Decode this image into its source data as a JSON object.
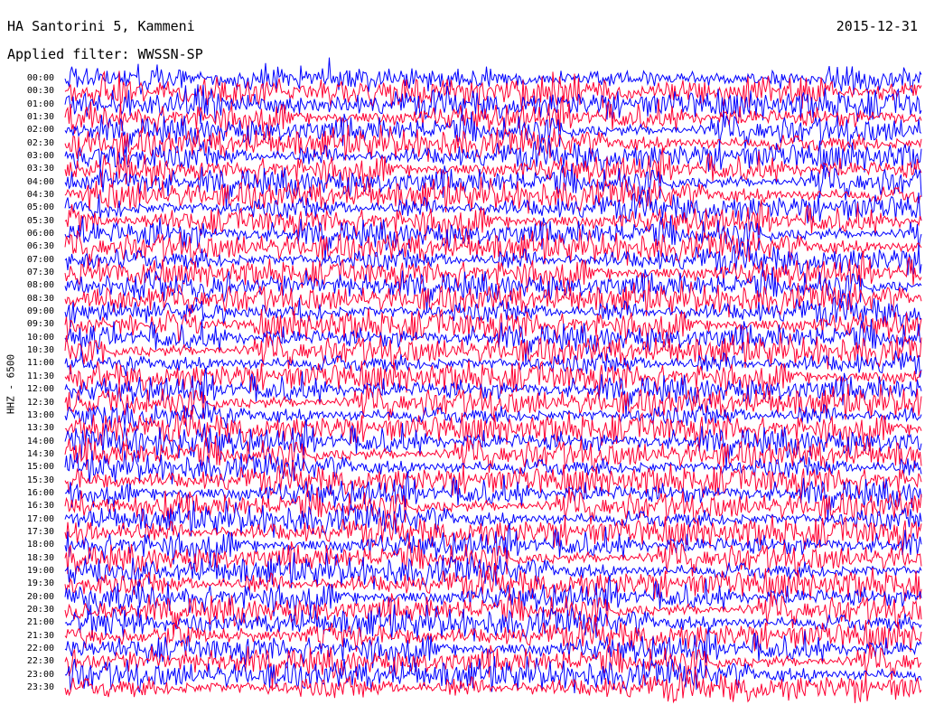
{
  "header": {
    "station": "HA Santorini 5, Kammeni",
    "date": "2015-12-31",
    "filter": "Applied filter: WWSSN-SP"
  },
  "channel_label": "HHZ - 6500",
  "colors": {
    "trace_a": "#0000ff",
    "trace_b": "#ff0033",
    "background": "#ffffff"
  },
  "chart_data": {
    "type": "line",
    "title": "HA Santorini 5, Kammeni",
    "subtitle": "Applied filter: WWSSN-SP",
    "ylabel": "HHZ - 6500",
    "row_labels": [
      "00:00",
      "00:30",
      "01:00",
      "01:30",
      "02:00",
      "02:30",
      "03:00",
      "03:30",
      "04:00",
      "04:30",
      "05:00",
      "05:30",
      "06:00",
      "06:30",
      "07:00",
      "07:30",
      "08:00",
      "08:30",
      "09:00",
      "09:30",
      "10:00",
      "10:30",
      "11:00",
      "11:30",
      "12:00",
      "12:30",
      "13:00",
      "13:30",
      "14:00",
      "14:30",
      "15:00",
      "15:30",
      "16:00",
      "16:30",
      "17:00",
      "17:30",
      "18:00",
      "18:30",
      "19:00",
      "19:30",
      "20:00",
      "20:30",
      "21:00",
      "21:30",
      "22:00",
      "22:30",
      "23:00",
      "23:30"
    ],
    "row_minutes": 30,
    "trace_colors": [
      "#0000ff",
      "#ff0033"
    ],
    "grid": false
  }
}
